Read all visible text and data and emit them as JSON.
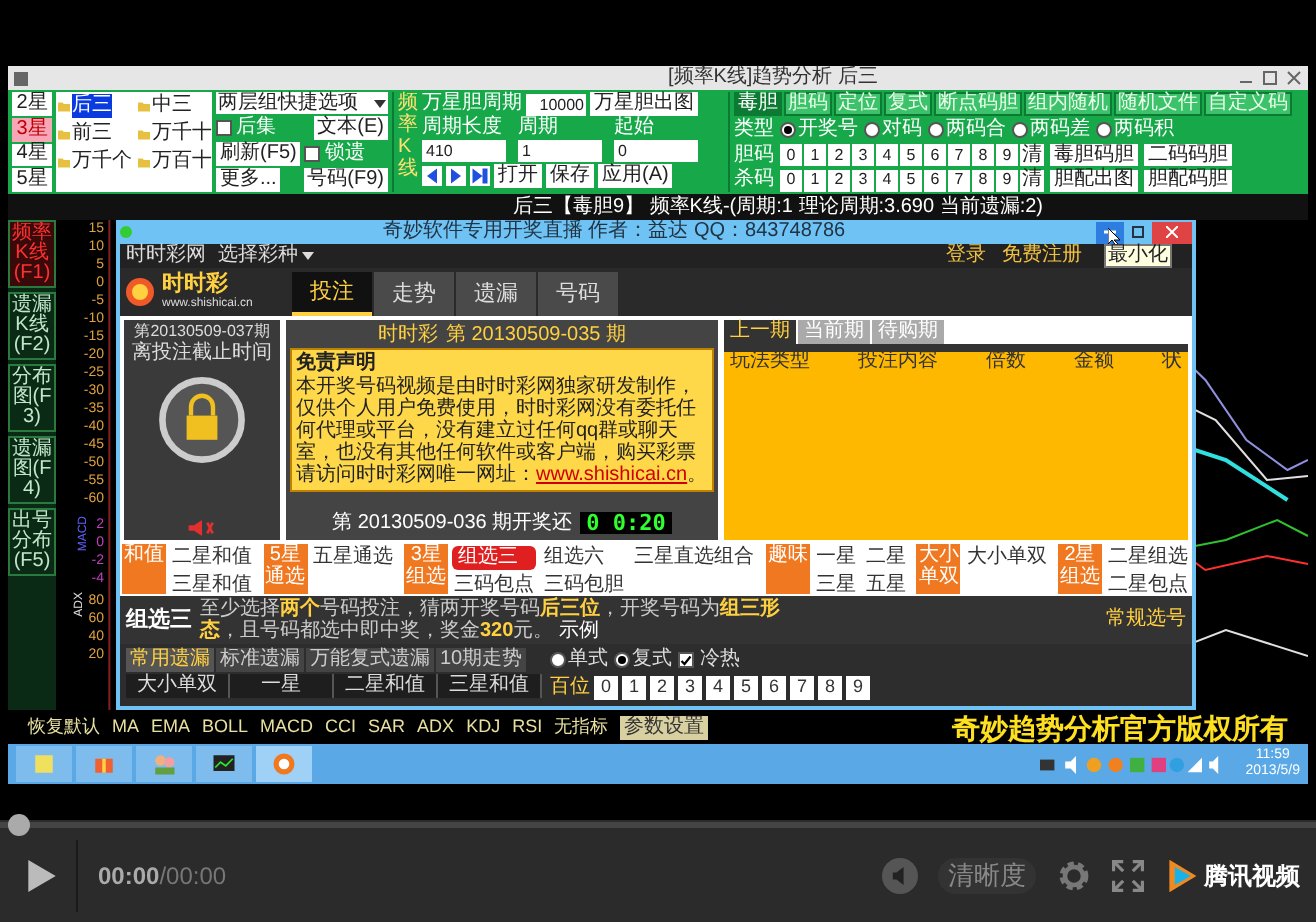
{
  "window": {
    "title": "[频率K线]趋势分析 后三"
  },
  "toolbar": {
    "star_buttons": [
      {
        "label": "2星",
        "selected": false
      },
      {
        "label": "3星",
        "selected": true
      },
      {
        "label": "4星",
        "selected": false
      },
      {
        "label": "5星",
        "selected": false
      }
    ],
    "tree_items": [
      {
        "label": "后三",
        "selected": true
      },
      {
        "label": "中三",
        "selected": false
      },
      {
        "label": "前三",
        "selected": false
      },
      {
        "label": "万千十",
        "selected": false
      },
      {
        "label": "万千个",
        "selected": false
      },
      {
        "label": "万百十",
        "selected": false
      }
    ],
    "preset_dropdown": "两层组快捷选项",
    "after_checkbox": {
      "label": "后集",
      "checked": false
    },
    "text_button": "文本(E)",
    "refresh_button": "刷新(F5)",
    "lock_checkbox": {
      "label": "锁遗",
      "checked": false
    },
    "more_dropdown": "更多...",
    "number_button": "号码(F9)",
    "mode_label": "频率K线",
    "period_label": "万星胆周期",
    "period_value": "10000",
    "chart_button": "万星胆出图",
    "params": [
      {
        "label": "周期长度",
        "value": "410"
      },
      {
        "label": "周期",
        "value": "1"
      },
      {
        "label": "起始",
        "value": "0"
      }
    ],
    "file_buttons": [
      "打开",
      "保存",
      "应用(A)"
    ],
    "tabs": [
      {
        "label": "毒胆",
        "selected": true
      },
      {
        "label": "胆码",
        "selected": false
      },
      {
        "label": "定位",
        "selected": false
      },
      {
        "label": "复式",
        "selected": false
      },
      {
        "label": "断点码胆",
        "selected": false
      },
      {
        "label": "组内随机",
        "selected": false
      },
      {
        "label": "随机文件",
        "selected": false
      },
      {
        "label": "自定义码",
        "selected": false
      }
    ],
    "type_label": "类型",
    "types": [
      {
        "label": "开奖号",
        "selected": true
      },
      {
        "label": "对码",
        "selected": false
      },
      {
        "label": "两码合",
        "selected": false
      },
      {
        "label": "两码差",
        "selected": false
      },
      {
        "label": "两码积",
        "selected": false
      }
    ],
    "digit_rows": [
      {
        "label": "胆码",
        "digits": [
          "0",
          "1",
          "2",
          "3",
          "4",
          "5",
          "6",
          "7",
          "8",
          "9"
        ],
        "clear": "清",
        "buttons": [
          "毒胆码胆",
          "二码码胆"
        ]
      },
      {
        "label": "杀码",
        "digits": [
          "0",
          "1",
          "2",
          "3",
          "4",
          "5",
          "6",
          "7",
          "8",
          "9"
        ],
        "clear": "清",
        "buttons": [
          "胆配出图",
          "胆配码胆"
        ]
      }
    ]
  },
  "status_text": "后三【毒胆9】 频率K线-(周期:1 理论周期:3.690 当前遗漏:2)",
  "side_tabs": [
    {
      "label": "频率K线(F1)",
      "selected": true
    },
    {
      "label": "遗漏K线(F2)",
      "selected": false
    },
    {
      "label": "分布图(F3)",
      "selected": false
    },
    {
      "label": "遗漏图(F4)",
      "selected": false
    },
    {
      "label": "出号分布(F5)",
      "selected": false
    }
  ],
  "chart": {
    "upper_ticks": [
      "15",
      "10",
      "5",
      "0",
      "-5",
      "-10",
      "-15",
      "-20",
      "-25",
      "-30",
      "-35",
      "-40",
      "-45",
      "-50",
      "-55",
      "-60"
    ],
    "macd_label": "MACD",
    "macd_ticks": [
      "2",
      "0",
      "-2",
      "-4"
    ],
    "adx_label": "ADX",
    "adx_ticks": [
      "80",
      "60",
      "40",
      "20"
    ]
  },
  "dialog": {
    "title": "奇妙软件专用开奖直播   作者：益达  QQ：843748786",
    "tooltip": "最小化",
    "nav_left": "时时彩网",
    "lottery_select": "选择彩种",
    "nav_right": [
      "登录",
      "免费注册"
    ],
    "logo_name": "时时彩",
    "logo_url": "www.shishicai.cn",
    "tabs": [
      {
        "label": "投注",
        "selected": true
      },
      {
        "label": "走势",
        "selected": false
      },
      {
        "label": "遗漏",
        "selected": false
      },
      {
        "label": "号码",
        "selected": false
      }
    ],
    "next_issue": "第20130509-037期",
    "deadline_label": "离投注截止时间",
    "draw_lottery": "时时彩",
    "draw_issue": "第 20130509-035 期",
    "notice_title": "免责声明",
    "notice_text": "本开奖号码视频是由时时彩网独家研发制作，仅供个人用户免费使用，时时彩网没有委托任何代理或平台，没有建立过任何qq群或聊天室，也没有其他任何软件或客户端，购买彩票请访问时时彩网唯一网址：",
    "notice_link": "www.shishicai.cn",
    "notice_end": "。",
    "countdown_label": "第 20130509-036 期开奖还",
    "countdown": "0 0:20",
    "record_tabs": [
      {
        "label": "上一期",
        "selected": true
      },
      {
        "label": "当前期",
        "selected": false
      },
      {
        "label": "待购期",
        "selected": false
      }
    ],
    "record_columns": [
      "玩法类型",
      "投注内容",
      "倍数",
      "金额",
      "状"
    ],
    "categories": [
      {
        "tag": "和值",
        "items": [
          {
            "label": "二星和值",
            "selected": false
          },
          {
            "label": "三星和值",
            "selected": false
          }
        ]
      },
      {
        "tag": "5星通选",
        "items": [
          {
            "label": "五星通选",
            "selected": false
          }
        ]
      },
      {
        "tag": "3星组选",
        "items": [
          {
            "label": "组选三",
            "selected": true
          },
          {
            "label": "组选六",
            "selected": false
          },
          {
            "label": "三星直选组合",
            "selected": false
          },
          {
            "label": "三码包点",
            "selected": false
          },
          {
            "label": "三码包胆",
            "selected": false
          }
        ]
      },
      {
        "tag": "趣味",
        "items": [
          {
            "label": "一星",
            "selected": false
          },
          {
            "label": "二星",
            "selected": false
          },
          {
            "label": "三星",
            "selected": false
          },
          {
            "label": "五星",
            "selected": false
          }
        ]
      },
      {
        "tag": "大小单双",
        "items": [
          {
            "label": "大小单双",
            "selected": false
          }
        ]
      },
      {
        "tag": "2星组选",
        "items": [
          {
            "label": "二星组选",
            "selected": false
          },
          {
            "label": "二星包点",
            "selected": false
          }
        ]
      }
    ],
    "play_name": "组选三",
    "play_desc": "至少选择**两个**号码投注，猜两开奖号码**后三位**，开奖号码为**组三形态**，且号码都选中即中奖，奖金**320**元。",
    "example_link": "示例",
    "pick_mode": "常规选号",
    "sub_tabs": [
      {
        "label": "常用遗漏",
        "selected": true
      },
      {
        "label": "标准遗漏",
        "selected": false
      },
      {
        "label": "万能复式遗漏",
        "selected": false
      },
      {
        "label": "10期走势",
        "selected": false
      }
    ],
    "table_columns": [
      "大小单双",
      "一星",
      "二星和值",
      "三星和值"
    ],
    "bet_modes": [
      {
        "label": "单式",
        "selected": false
      },
      {
        "label": "复式",
        "selected": true
      }
    ],
    "hot_cold": {
      "label": "冷热",
      "checked": true
    },
    "digit_label": "百位",
    "digits": [
      "0",
      "1",
      "2",
      "3",
      "4",
      "5",
      "6",
      "7",
      "8",
      "9"
    ]
  },
  "indicator_bar": {
    "items": [
      {
        "label": "恢复默认",
        "kind": "text"
      },
      {
        "label": "MA",
        "kind": "text"
      },
      {
        "label": "EMA",
        "kind": "text"
      },
      {
        "label": "BOLL",
        "kind": "text"
      },
      {
        "label": "MACD",
        "kind": "text"
      },
      {
        "label": "CCI",
        "kind": "text"
      },
      {
        "label": "SAR",
        "kind": "text"
      },
      {
        "label": "ADX",
        "kind": "text"
      },
      {
        "label": "KDJ",
        "kind": "text"
      },
      {
        "label": "RSI",
        "kind": "text"
      },
      {
        "label": "无指标",
        "kind": "text"
      },
      {
        "label": "参数设置",
        "kind": "button"
      }
    ],
    "caption": "奇妙趋势分析官方版权所有"
  },
  "taskbar": {
    "apps": [
      {
        "kind": "note",
        "selected": false
      },
      {
        "kind": "gift",
        "selected": false
      },
      {
        "kind": "people",
        "selected": false
      },
      {
        "kind": "monitor",
        "selected": false
      },
      {
        "kind": "s-logo",
        "selected": true
      }
    ],
    "time": "11:59",
    "date": "2013/5/9"
  },
  "player": {
    "progress": {
      "level": 0
    },
    "time_current": "00:00",
    "time_separator": "/",
    "time_total": "00:00",
    "quality": "清晰度",
    "brand": "腾讯视频"
  }
}
